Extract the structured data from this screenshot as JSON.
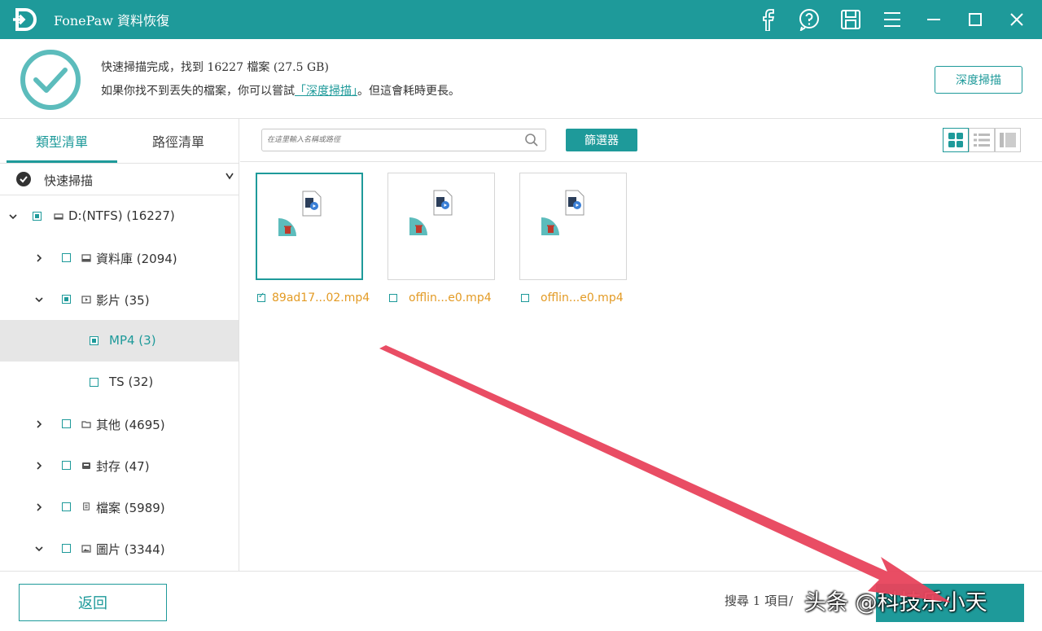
{
  "app": {
    "title": "FonePaw 資料恢復"
  },
  "summary": {
    "line1": "快速掃描完成，找到 16227 檔案 (27.5 GB)",
    "line2_before": "如果你找不到丟失的檔案，你可以嘗試",
    "line2_link": "「深度掃描」",
    "line2_after": "。但這會耗時更長。",
    "deep_scan_label": "深度掃描"
  },
  "sidebar": {
    "tabs": [
      "類型清單",
      "路徑清單"
    ],
    "scan_label": "快速掃描",
    "tree": [
      {
        "label": "D:(NTFS) (16227)",
        "level": 0,
        "expanded": true,
        "checkbox": "partial",
        "icon": "drive-icon"
      },
      {
        "label": "資料庫 (2094)",
        "level": 1,
        "expanded": false,
        "checkbox": "empty",
        "icon": "database-icon"
      },
      {
        "label": "影片 (35)",
        "level": 1,
        "expanded": true,
        "checkbox": "partial",
        "icon": "video-icon"
      },
      {
        "label": "MP4 (3)",
        "level": 2,
        "checkbox": "partial",
        "selected": true
      },
      {
        "label": "TS (32)",
        "level": 2,
        "checkbox": "empty"
      },
      {
        "label": "其他 (4695)",
        "level": 1,
        "expanded": false,
        "checkbox": "empty",
        "icon": "folder-icon"
      },
      {
        "label": "封存 (47)",
        "level": 1,
        "expanded": false,
        "checkbox": "empty",
        "icon": "archive-icon"
      },
      {
        "label": "檔案 (5989)",
        "level": 1,
        "expanded": false,
        "checkbox": "empty",
        "icon": "document-icon"
      },
      {
        "label": "圖片 (3344)",
        "level": 1,
        "expanded": true,
        "checkbox": "empty",
        "icon": "image-icon"
      }
    ]
  },
  "toolbar": {
    "search_placeholder": "在這里輸入名稱或路徑",
    "filter_label": "篩選器"
  },
  "files": [
    {
      "name": "89ad17...02.mp4",
      "checked": true
    },
    {
      "name": "offlin...e0.mp4",
      "checked": false
    },
    {
      "name": "offlin...e0.mp4",
      "checked": false
    }
  ],
  "bottom": {
    "back_label": "返回",
    "status": "搜尋 1 項目/",
    "watermark": "头条 @科技乐小天"
  },
  "colors": {
    "accent": "#1e9a9a",
    "file_name": "#e39b25",
    "arrow": "#e8435c"
  }
}
